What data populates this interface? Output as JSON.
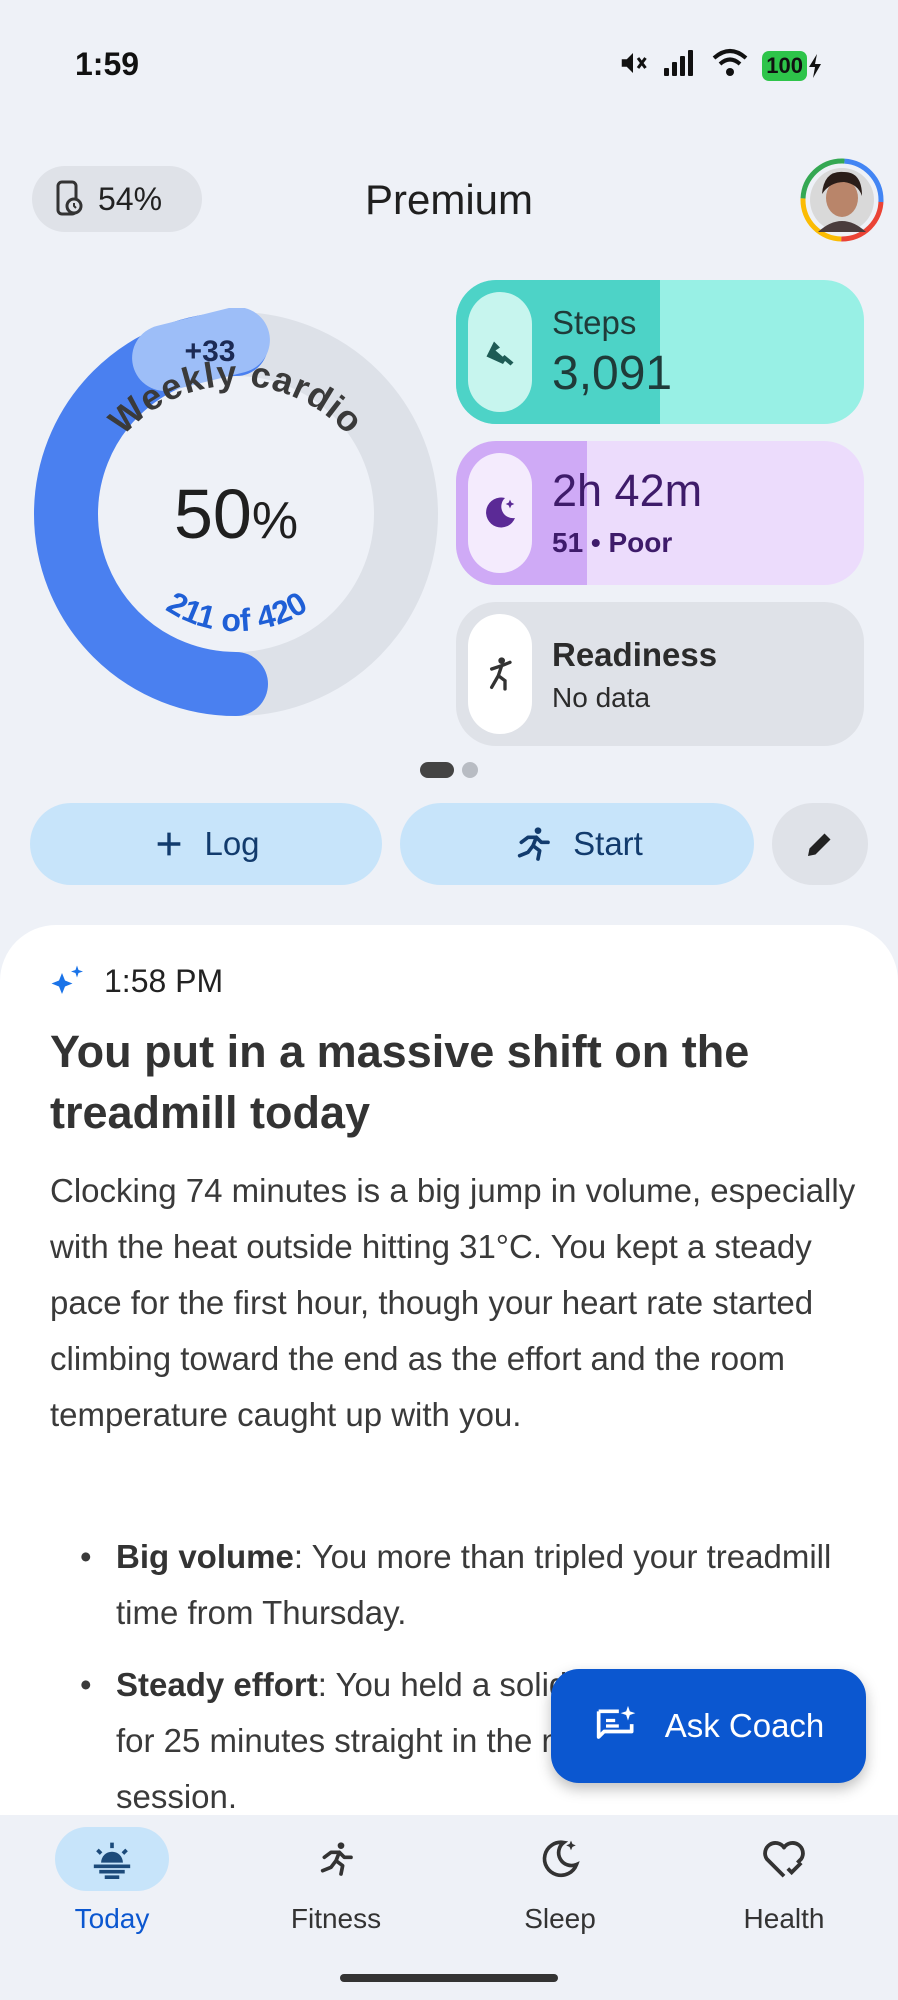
{
  "status_bar": {
    "time": "1:59",
    "battery": "100"
  },
  "header": {
    "device_battery": "54%",
    "title": "Premium"
  },
  "weekly_cardio": {
    "label": "Weekly cardio",
    "badge": "+33",
    "percent_value": "50",
    "percent_sign": "%",
    "progress": "211 of 420",
    "progress_fraction": 0.5
  },
  "cards": {
    "steps": {
      "title": "Steps",
      "value": "3,091"
    },
    "sleep": {
      "value": "2h 42m",
      "sub": "51 • Poor"
    },
    "readiness": {
      "title": "Readiness",
      "sub": "No data"
    }
  },
  "actions": {
    "log": "Log",
    "start": "Start"
  },
  "insight": {
    "time": "1:58 PM",
    "title": "You put in a massive shift on the treadmill today",
    "body": "Clocking 74 minutes is a big jump in volume, especially with the heat outside hitting 31°C. You kept a steady pace for the first hour, though your heart rate started climbing toward the end as the effort and the room temperature caught up with you.",
    "bullets": [
      {
        "bold": "Big volume",
        "text": ": You more than tripled your treadmill time from Thursday."
      },
      {
        "bold": "Steady effort",
        "text": ": You held a solid aerobic rhythm for 25 minutes straight in the middle of the session."
      }
    ]
  },
  "ask_coach": "Ask Coach",
  "nav": {
    "today": "Today",
    "fitness": "Fitness",
    "sleep": "Sleep",
    "health": "Health"
  },
  "colors": {
    "accent": "#0b57d0",
    "ring": "#4a80f0",
    "steps": "#4dd3c7",
    "sleep": "#cfaaf6"
  }
}
